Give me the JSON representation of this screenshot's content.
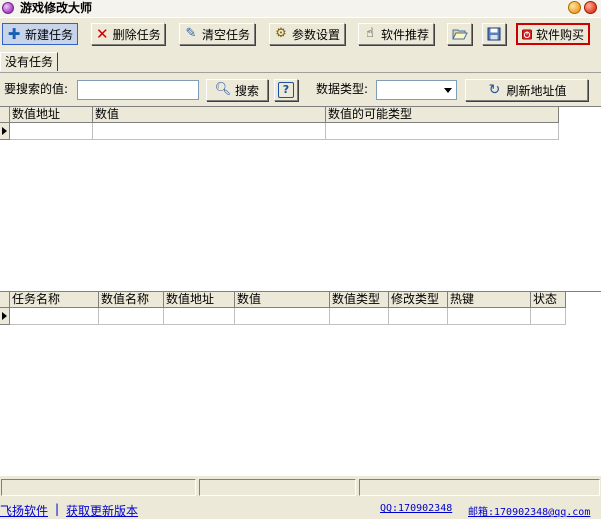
{
  "window": {
    "title": "游戏修改大师"
  },
  "toolbar": {
    "new_task": "新建任务",
    "delete_task": "删除任务",
    "clear_tasks": "清空任务",
    "settings": "参数设置",
    "recommend": "软件推荐",
    "buy": "软件购买"
  },
  "tabs": [
    {
      "label": "没有任务"
    }
  ],
  "search": {
    "value_label": "要搜索的值:",
    "value": "",
    "search_button": "搜索",
    "help_button": "?",
    "type_label": "数据类型:",
    "type_value": "",
    "refresh_button": "刷新地址值"
  },
  "results_table": {
    "columns": [
      "数值地址",
      "数值",
      "数值的可能类型"
    ]
  },
  "tasks_table": {
    "columns": [
      "任务名称",
      "数值名称",
      "数值地址",
      "数值",
      "数值类型",
      "修改类型",
      "热键",
      "状态"
    ]
  },
  "footer": {
    "company": "飞扬软件",
    "separator": "|",
    "update": "获取更新版本",
    "qq": "QQ:170902348",
    "email": "邮箱:170902348@qq.com"
  },
  "colors": {
    "titlebar": "#f4f3ee",
    "face": "#ece9d8",
    "link": "#0000cc",
    "buy_border": "#cc0000"
  }
}
